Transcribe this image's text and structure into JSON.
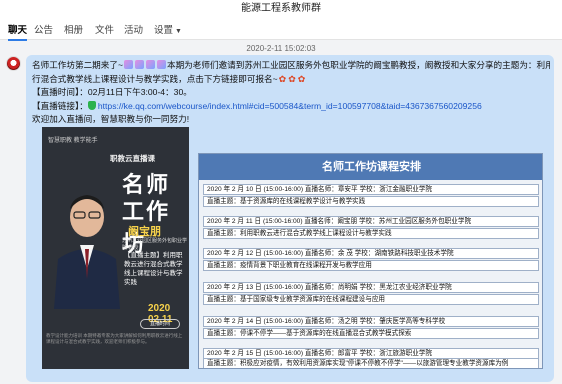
{
  "window": {
    "title": "能源工程系教师群"
  },
  "tabs": [
    {
      "label": "聊天"
    },
    {
      "label": "公告"
    },
    {
      "label": "相册"
    },
    {
      "label": "文件"
    },
    {
      "label": "活动"
    },
    {
      "label": "设置"
    }
  ],
  "timestamp": "2020-2-11 15:02:03",
  "message": {
    "line1_a": "名师工作坊第二期来了~",
    "line1_b": "本期为老师们邀请到苏州工业园区服务外包职业学院的阚宝鹏教授，阚教授和大家分享的主题为：利用职教云进",
    "line2": "行混合式教学线上课程设计与教学实践，点击下方链接即可报名~",
    "time_label": "【直播时间】：",
    "time_value": "02月11日下午3:00-4：30。",
    "link_label": "【直播链接】：",
    "link_url": "https://ke.qq.com/webcourse/index.html#cid=500584&term_id=100597708&taid=4367367560209256",
    "closing": "欢迎加入直播间，智慧职教与你一同努力!"
  },
  "poster": {
    "header": "智慧职教  教学能手",
    "subtitle": "职教云直播课",
    "title1": "名师",
    "title2": "工作坊",
    "name": "阚宝朋",
    "affiliation": "苏州工业园区服务外包职业学院 教授",
    "topic": "【直播主题】利用职教云进行混合式教学线上课程设计与教学实践",
    "date": "2020 02.11",
    "button": "直播时间",
    "footer": "教学设计能力培训 本期特邀专家为大家讲解如何利用职教云进行线上课程设计与混合式教学实践，欢迎老师们积极参与。"
  },
  "schedule": {
    "title": "名师工作坊课程安排",
    "rows": [
      {
        "text": "2020 年 2 月 10 日  (15:00-16:00)    直播名师：章安平          学校：浙江金融职业学院"
      },
      {
        "text": "直播主题：基于资源库的在线课程教学设计与教学实践"
      },
      {
        "text": "2020 年 2 月 11 日  (15:00-16:00)    直播名师：阚宝朋          学校：苏州工业园区服务外包职业学院"
      },
      {
        "text": "直播主题：利用职教云进行混合式教学线上课程设计与教学实践"
      },
      {
        "text": "2020 年 2 月 12 日  (15:00-16:00)    直播名师：余  茂          学校：湖南铁路科技职业技术学院"
      },
      {
        "text": "直播主题：疫情背景下职业教育在线课程开发与教学应用"
      },
      {
        "text": "2020 年 2 月 13 日  (15:00-16:00)    直播名师：尚明娟          学校：黑龙江农业经济职业学院"
      },
      {
        "text": "直播主题：基于国家级专业教学资源库的在线课程建设与应用"
      },
      {
        "text": "2020 年 2 月 14 日  (15:00-16:00)    直播名师：汤之明          学校：肇庆医学高等专科学校"
      },
      {
        "text": "直播主题：停课不停学——基于资源库的在线直播混合式教学模式探索"
      },
      {
        "text": "2020 年 2 月 15 日  (15:00-16:00)    直播名师：郎富平          学校：浙江旅游职业学院"
      },
      {
        "text": "直播主题：积极应对疫情，有效利用资源库实现\"停课不停教不停学\"——以旅游管理专业教学资源库为例"
      }
    ]
  },
  "colors": {
    "accent": "#2d7be5",
    "bubble": "#c9e0f8",
    "schedule_header": "#4f79b4"
  },
  "icons": {
    "avatar": "group-avatar",
    "emoji": "sparkle-emoji",
    "flower": "rose-emoji",
    "shield": "security-shield-icon"
  }
}
